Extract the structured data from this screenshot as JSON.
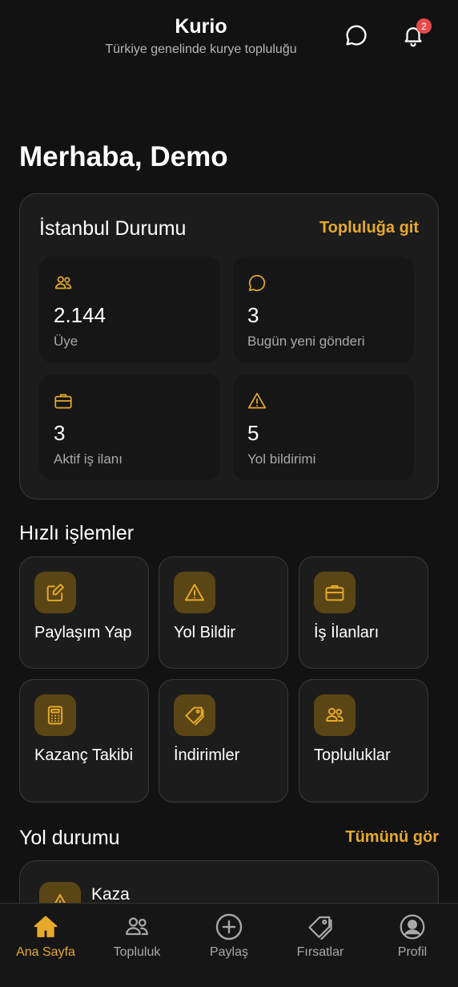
{
  "header": {
    "title": "Kurio",
    "subtitle": "Türkiye genelinde kurye topluluğu",
    "notification_count": "2"
  },
  "greeting": "Merhaba, Demo",
  "status": {
    "title": "İstanbul Durumu",
    "link": "Topluluğa git",
    "stats": [
      {
        "value": "2.144",
        "label": "Üye",
        "icon": "users-icon"
      },
      {
        "value": "3",
        "label": "Bugün yeni gönderi",
        "icon": "chat-icon"
      },
      {
        "value": "3",
        "label": "Aktif iş ilanı",
        "icon": "briefcase-icon"
      },
      {
        "value": "5",
        "label": "Yol bildirimi",
        "icon": "warning-icon"
      }
    ]
  },
  "quick_actions": {
    "title": "Hızlı işlemler",
    "items": [
      {
        "label": "Paylaşım Yap",
        "icon": "edit-icon"
      },
      {
        "label": "Yol Bildir",
        "icon": "warning-icon"
      },
      {
        "label": "İş İlanları",
        "icon": "briefcase-icon"
      },
      {
        "label": "Kazanç Takibi",
        "icon": "calculator-icon"
      },
      {
        "label": "İndirimler",
        "icon": "tag-icon"
      },
      {
        "label": "Topluluklar",
        "icon": "users-icon"
      }
    ]
  },
  "road": {
    "title": "Yol durumu",
    "see_all": "Tümünü gör",
    "items": [
      {
        "title": "Kaza",
        "icon": "warning-icon"
      }
    ]
  },
  "nav": {
    "items": [
      {
        "label": "Ana Sayfa",
        "icon": "home-icon",
        "active": true
      },
      {
        "label": "Topluluk",
        "icon": "users-icon",
        "active": false
      },
      {
        "label": "Paylaş",
        "icon": "plus-circle-icon",
        "active": false
      },
      {
        "label": "Fırsatlar",
        "icon": "tag-icon",
        "active": false
      },
      {
        "label": "Profil",
        "icon": "profile-icon",
        "active": false
      }
    ]
  },
  "colors": {
    "background": "#121212",
    "card": "#1c1c1c",
    "accent": "#e6a92b",
    "icon_bg": "#5a4514",
    "badge": "#e84b4b"
  }
}
